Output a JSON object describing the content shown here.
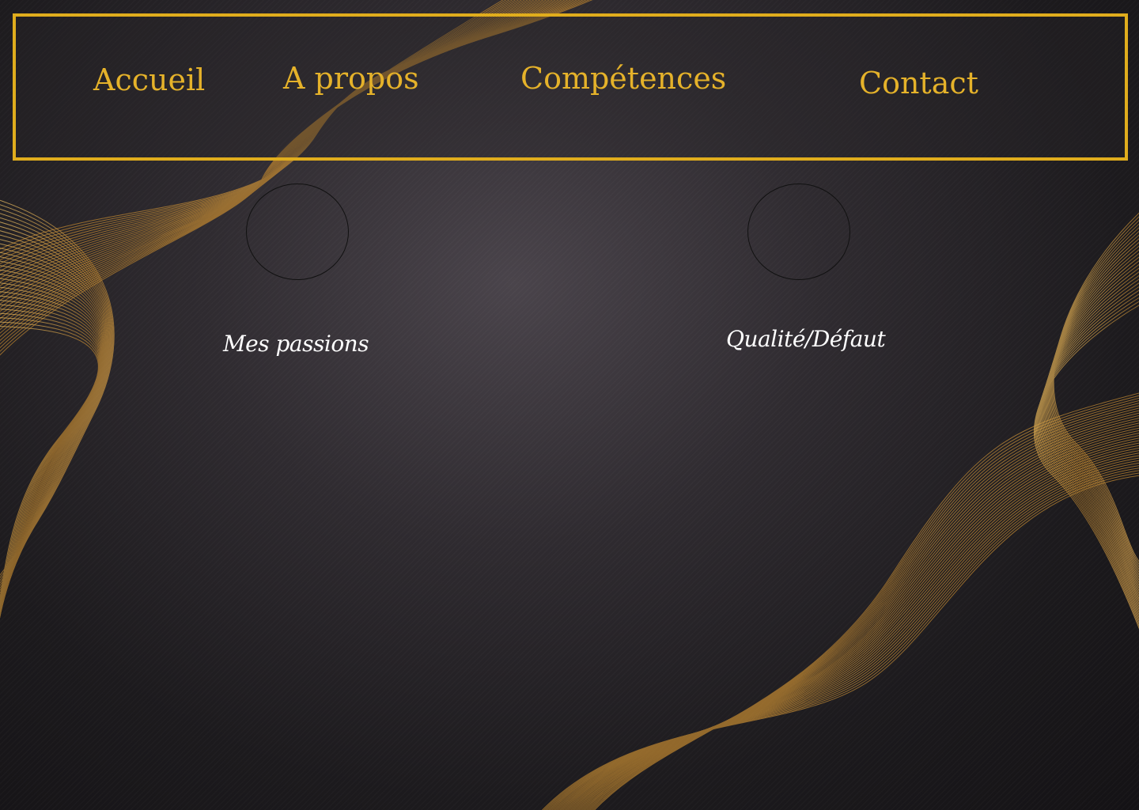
{
  "nav": {
    "items": [
      {
        "label": "Accueil"
      },
      {
        "label": "A propos"
      },
      {
        "label": "Compétences"
      },
      {
        "label": "Contact"
      }
    ]
  },
  "sections": {
    "passions": {
      "label": "Mes passions"
    },
    "qualite": {
      "label": "Qualité/Défaut"
    }
  },
  "colors": {
    "accent": "#e0ad1d",
    "text_light": "#ffffff",
    "background": "#2f2b30"
  },
  "icons": {
    "background": "gold-wave-lines-decoration"
  }
}
